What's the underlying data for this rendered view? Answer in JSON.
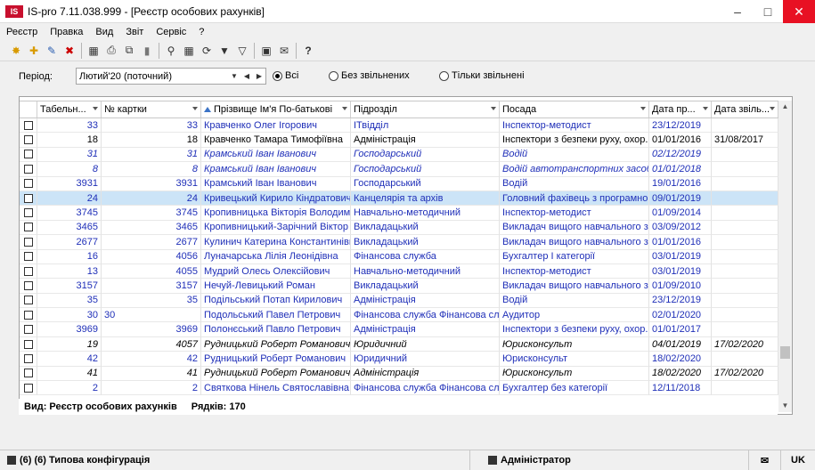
{
  "window": {
    "title": "IS-pro 7.11.038.999 - [Реєстр особових рахунків]",
    "logo": "IS"
  },
  "menu": [
    "Реєстр",
    "Правка",
    "Вид",
    "Звіт",
    "Сервіс",
    "?"
  ],
  "toolbar_icons": [
    "new-icon",
    "add-icon",
    "edit-icon",
    "delete-icon",
    "calc-icon",
    "print-icon",
    "copy-icon",
    "cards-icon",
    "search-icon",
    "table-icon",
    "refresh-icon",
    "filter-icon",
    "clear-filter-icon",
    "window-icon",
    "mail-icon",
    "help-icon"
  ],
  "filter": {
    "period_label": "Період:",
    "period_value": "Лютий'20 (поточний)",
    "radio_all": "Всі",
    "radio_no_dismissed": "Без звільнених",
    "radio_only_dismissed": "Тільки звільнені"
  },
  "columns": [
    "",
    "Табельн...",
    "№ картки",
    "Прізвище Ім'я По-батькові",
    "Підрозділ",
    "Посада",
    "Дата пр...",
    "Дата звіль..."
  ],
  "rows": [
    {
      "tab": "33",
      "card": "33",
      "name": "Кравченко Олег Ігорович",
      "dept": "ІТвідділ",
      "pos": "Інспектор-методист",
      "hire": "23/12/2019",
      "fire": "",
      "style": "blue"
    },
    {
      "tab": "18",
      "card": "18",
      "name": "Кравченко Тамара Тимофіївна",
      "dept": "Адміністрація",
      "pos": "Інспектори з безпеки руху, охор...",
      "hire": "01/01/2016",
      "fire": "31/08/2017",
      "style": "black"
    },
    {
      "tab": "31",
      "card": "31",
      "name": "Крамський Іван Іванович",
      "dept": "Господарський",
      "pos": "Водій",
      "hire": "02/12/2019",
      "fire": "",
      "style": "blue italic"
    },
    {
      "tab": "8",
      "card": "8",
      "name": "Крамський Іван Іванович",
      "dept": "Господарський",
      "pos": "Водій автотранспортних засобів",
      "hire": "01/01/2018",
      "fire": "",
      "style": "blue italic"
    },
    {
      "tab": "3931",
      "card": "3931",
      "name": "Крамський Іван Іванович",
      "dept": "Господарський",
      "pos": "Водій",
      "hire": "19/01/2016",
      "fire": "",
      "style": "blue"
    },
    {
      "tab": "24",
      "card": "24",
      "name": "Кривецький Кирило Кіндратович",
      "dept": "Канцелярія та архів",
      "pos": "Головний фахівець з програмного...",
      "hire": "09/01/2019",
      "fire": "",
      "style": "blue sel"
    },
    {
      "tab": "3745",
      "card": "3745",
      "name": "Кропивницька Вікторія Володими...",
      "dept": "Навчально-методичний",
      "pos": "Інспектор-методист",
      "hire": "01/09/2014",
      "fire": "",
      "style": "blue"
    },
    {
      "tab": "3465",
      "card": "3465",
      "name": "Кропивницький-Зарічний Віктор В...",
      "dept": "Викладацький",
      "pos": "Викладач вищого навчального за...",
      "hire": "03/09/2012",
      "fire": "",
      "style": "blue"
    },
    {
      "tab": "2677",
      "card": "2677",
      "name": "Кулинич Катерина Константинівна",
      "dept": "Викладацький",
      "pos": "Викладач вищого навчального за...",
      "hire": "01/01/2016",
      "fire": "",
      "style": "blue"
    },
    {
      "tab": "16",
      "card": "4056",
      "name": "Луначарська Лілія Леонідівна",
      "dept": "Фінансова служба",
      "pos": "Бухгалтер І категорії",
      "hire": "03/01/2019",
      "fire": "",
      "style": "blue"
    },
    {
      "tab": "13",
      "card": "4055",
      "name": "Мудрий Олесь Олексійович",
      "dept": "Навчально-методичний",
      "pos": "Інспектор-методист",
      "hire": "03/01/2019",
      "fire": "",
      "style": "blue"
    },
    {
      "tab": "3157",
      "card": "3157",
      "name": "Нечуй-Левицький Роман",
      "dept": "Викладацький",
      "pos": "Викладач вищого навчального за...",
      "hire": "01/09/2010",
      "fire": "",
      "style": "blue"
    },
    {
      "tab": "35",
      "card": "35",
      "name": "Подільський Потап Кирилович",
      "dept": "Адміністрація",
      "pos": "Водій",
      "hire": "23/12/2019",
      "fire": "",
      "style": "blue"
    },
    {
      "tab": "30",
      "card": "30",
      "name": "Подольський Павел Петрович",
      "dept": "Фінансова служба   Фінансова сл...",
      "pos": "Аудитор",
      "hire": "02/01/2020",
      "fire": "",
      "style": "blue leftcard"
    },
    {
      "tab": "3969",
      "card": "3969",
      "name": "Полонєський Павло Петрович",
      "dept": "Адміністрація",
      "pos": "Інспектори з безпеки руху, охор...",
      "hire": "01/01/2017",
      "fire": "",
      "style": "blue"
    },
    {
      "tab": "19",
      "card": "4057",
      "name": "Рудницький Роберт Романович",
      "dept": "Юридичний",
      "pos": "Юрисконсульт",
      "hire": "04/01/2019",
      "fire": "17/02/2020",
      "style": "black italic"
    },
    {
      "tab": "42",
      "card": "42",
      "name": "Рудницький Роберт Романович",
      "dept": "Юридичний",
      "pos": "Юрисконсульт",
      "hire": "18/02/2020",
      "fire": "",
      "style": "blue"
    },
    {
      "tab": "41",
      "card": "41",
      "name": "Рудницький Роберт Романович",
      "dept": "Адміністрація",
      "pos": "Юрисконсульт",
      "hire": "18/02/2020",
      "fire": "17/02/2020",
      "style": "black italic"
    },
    {
      "tab": "2",
      "card": "2",
      "name": "Святкова Нінель Святославівна",
      "dept": "Фінансова служба   Фінансова сл...",
      "pos": "Бухгалтер без категорії",
      "hire": "12/11/2018",
      "fire": "",
      "style": "blue"
    }
  ],
  "footer": {
    "view_label": "Вид: Реєстр особових рахунків",
    "rows_label": "Рядків: 170"
  },
  "status": {
    "config": "(6) (6) Типова конфігурація",
    "user": "Адміністратор",
    "lang": "UK"
  }
}
